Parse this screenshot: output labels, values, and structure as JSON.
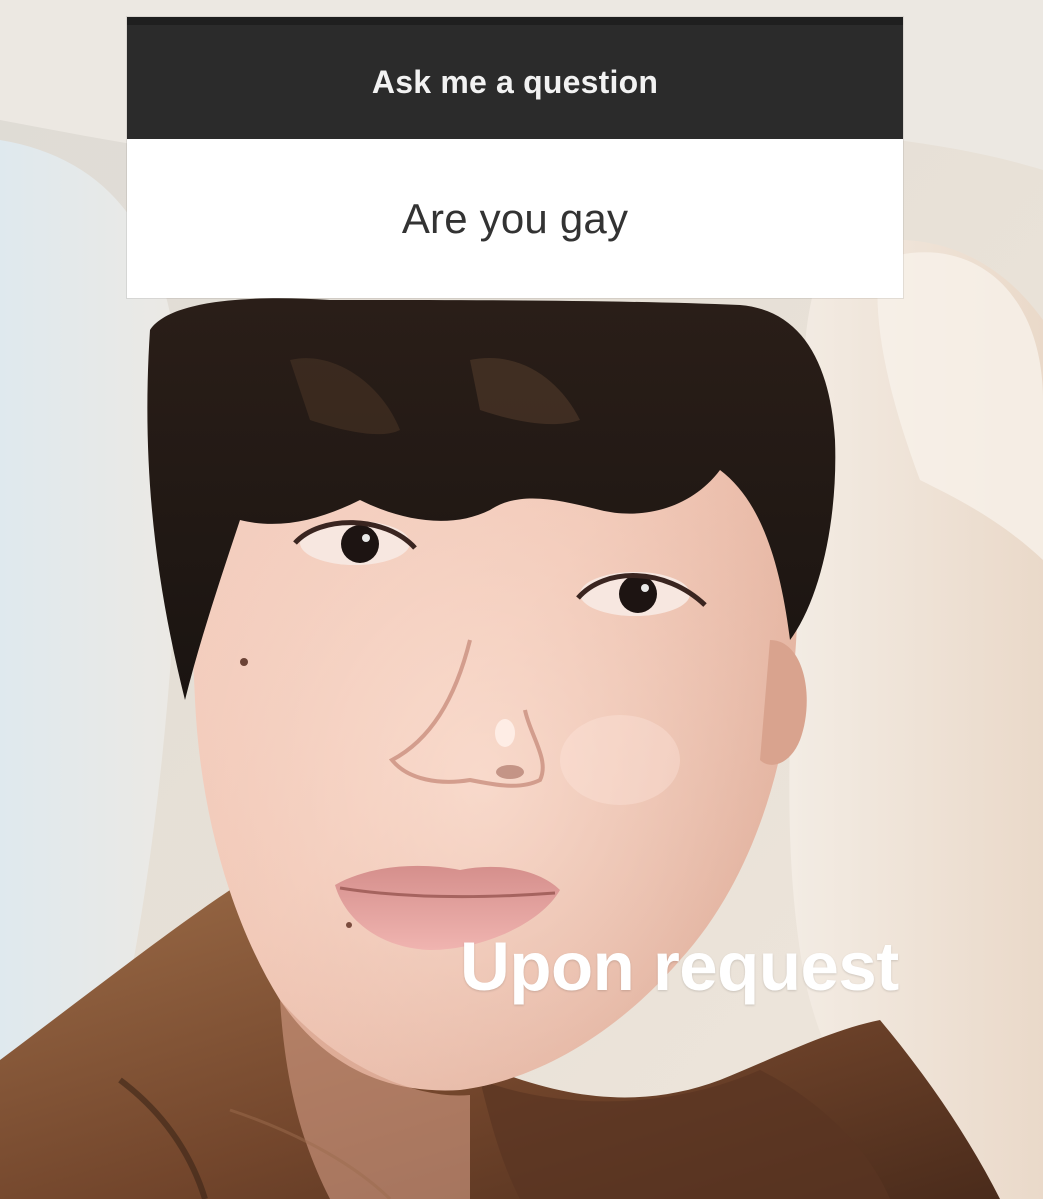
{
  "question_sticker": {
    "header": "Ask me a question",
    "question": "Are you gay"
  },
  "caption": "Upon request"
}
